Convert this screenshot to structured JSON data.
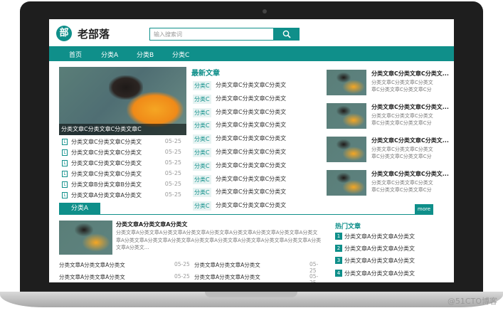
{
  "brand": {
    "logo_glyph": "部",
    "name": "老部落"
  },
  "search": {
    "placeholder": "输入搜索词"
  },
  "nav": [
    "首页",
    "分类A",
    "分类B",
    "分类C"
  ],
  "hero": {
    "caption": "分类文章C分类文章C分类文章C"
  },
  "mini_list": [
    {
      "title": "分类文章C分类文章C分类文",
      "date": "05-25"
    },
    {
      "title": "分类文章C分类文章C分类文",
      "date": "05-25"
    },
    {
      "title": "分类文章C分类文章C分类文",
      "date": "05-25"
    },
    {
      "title": "分类文章C分类文章C分类文",
      "date": "05-25"
    },
    {
      "title": "分类文章B分类文章B分类文",
      "date": "05-25"
    },
    {
      "title": "分类文章A分类文章A分类文",
      "date": "05-25"
    }
  ],
  "latest": {
    "title": "最新文章",
    "items": [
      {
        "tag": "分类C",
        "title": "分类文章C分类文章C分类文"
      },
      {
        "tag": "分类C",
        "title": "分类文章C分类文章C分类文"
      },
      {
        "tag": "分类C",
        "title": "分类文章C分类文章C分类文"
      },
      {
        "tag": "分类C",
        "title": "分类文章C分类文章C分类文"
      },
      {
        "tag": "分类C",
        "title": "分类文章C分类文章C分类文"
      },
      {
        "tag": "分类C",
        "title": "分类文章C分类文章C分类文"
      },
      {
        "tag": "分类C",
        "title": "分类文章C分类文章C分类文"
      },
      {
        "tag": "分类C",
        "title": "分类文章C分类文章C分类文"
      },
      {
        "tag": "分类C",
        "title": "分类文章C分类文章C分类文"
      },
      {
        "tag": "分类C",
        "title": "分类文章C分类文章C分类文"
      }
    ]
  },
  "right_list": [
    {
      "title": "分类文章C分类文章C分类文...",
      "desc": "分类文章C分类文章C分类文章C分类文章C分类文章C分类文章C"
    },
    {
      "title": "分类文章C分类文章C分类文...",
      "desc": "分类文章C分类文章C分类文章C分类文章C分类文章C分类文章C"
    },
    {
      "title": "分类文章C分类文章C分类文...",
      "desc": "分类文章C分类文章C分类文章C分类文章C分类文章C分类文章C"
    },
    {
      "title": "分类文章C分类文章C分类文...",
      "desc": "分类文章C分类文章C分类文章C分类文章C分类文章C分类文章C"
    }
  ],
  "section": {
    "title": "分类A",
    "more_label": "more"
  },
  "feature": {
    "title": "分类文章A分类文章A分类文",
    "desc": "分类文章A分类文章A分类文章A分类文章A分类文章A分类文章A分类文章A分类文章A分类文章A分类文章A分类文章A分类文章A分类文章A分类文章A分类文章A分类文章A分类文章A分类文章A分类文..."
  },
  "bottom_rows": [
    {
      "a": "分类文章A分类文章A分类文",
      "da": "05-25",
      "b": "分类文章A分类文章A分类文",
      "db": "05-25"
    },
    {
      "a": "分类文章A分类文章A分类文",
      "da": "05-25",
      "b": "分类文章A分类文章A分类文",
      "db": "05-25"
    }
  ],
  "hot": {
    "title": "热门文章",
    "items": [
      {
        "n": "1",
        "title": "分类文章A分类文章A分类文"
      },
      {
        "n": "2",
        "title": "分类文章A分类文章A分类文"
      },
      {
        "n": "3",
        "title": "分类文章A分类文章A分类文"
      },
      {
        "n": "4",
        "title": "分类文章A分类文章A分类文"
      }
    ]
  },
  "watermark": "@51CTO博客",
  "colors": {
    "accent": "#0f8f8a"
  }
}
